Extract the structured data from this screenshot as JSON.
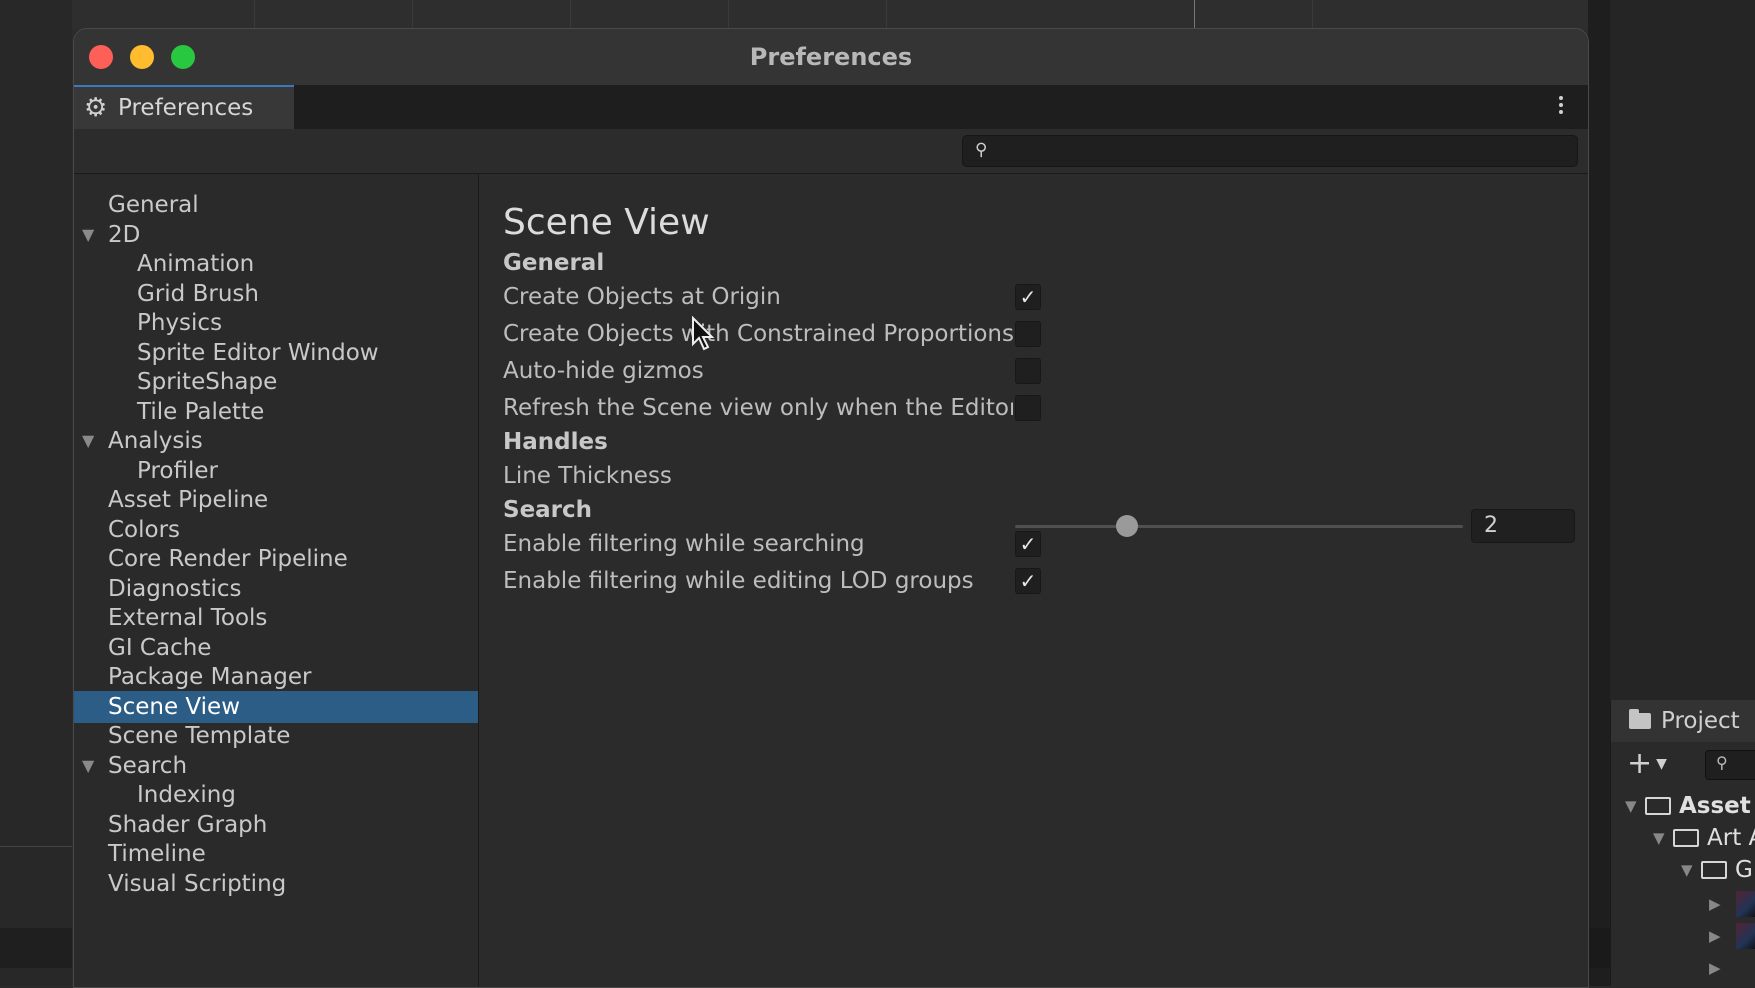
{
  "window": {
    "title": "Preferences"
  },
  "tab": {
    "label": "Preferences",
    "icon": "gear-icon"
  },
  "search": {
    "placeholder": "",
    "value": ""
  },
  "sidebar": {
    "items": [
      {
        "label": "General",
        "level": 0,
        "expandable": false
      },
      {
        "label": "2D",
        "level": 0,
        "expandable": true
      },
      {
        "label": "Animation",
        "level": 1,
        "expandable": false
      },
      {
        "label": "Grid Brush",
        "level": 1,
        "expandable": false
      },
      {
        "label": "Physics",
        "level": 1,
        "expandable": false
      },
      {
        "label": "Sprite Editor Window",
        "level": 1,
        "expandable": false
      },
      {
        "label": "SpriteShape",
        "level": 1,
        "expandable": false
      },
      {
        "label": "Tile Palette",
        "level": 1,
        "expandable": false
      },
      {
        "label": "Analysis",
        "level": 0,
        "expandable": true
      },
      {
        "label": "Profiler",
        "level": 1,
        "expandable": false
      },
      {
        "label": "Asset Pipeline",
        "level": 0,
        "expandable": false
      },
      {
        "label": "Colors",
        "level": 0,
        "expandable": false
      },
      {
        "label": "Core Render Pipeline",
        "level": 0,
        "expandable": false
      },
      {
        "label": "Diagnostics",
        "level": 0,
        "expandable": false
      },
      {
        "label": "External Tools",
        "level": 0,
        "expandable": false
      },
      {
        "label": "GI Cache",
        "level": 0,
        "expandable": false
      },
      {
        "label": "Package Manager",
        "level": 0,
        "expandable": false
      },
      {
        "label": "Scene View",
        "level": 0,
        "expandable": false,
        "selected": true
      },
      {
        "label": "Scene Template",
        "level": 0,
        "expandable": false
      },
      {
        "label": "Search",
        "level": 0,
        "expandable": true
      },
      {
        "label": "Indexing",
        "level": 1,
        "expandable": false
      },
      {
        "label": "Shader Graph",
        "level": 0,
        "expandable": false
      },
      {
        "label": "Timeline",
        "level": 0,
        "expandable": false
      },
      {
        "label": "Visual Scripting",
        "level": 0,
        "expandable": false
      }
    ]
  },
  "content": {
    "title": "Scene View",
    "general": {
      "header": "General",
      "create_origin": {
        "label": "Create Objects at Origin",
        "checked": true
      },
      "create_constrained": {
        "label": "Create Objects with Constrained Proportions",
        "checked": false
      },
      "autohide_gizmos": {
        "label": "Auto-hide gizmos",
        "checked": false
      },
      "refresh_scene": {
        "label": "Refresh the Scene view only when the Editor",
        "checked": false
      }
    },
    "handles": {
      "header": "Handles",
      "line_thickness": {
        "label": "Line Thickness",
        "value": "2",
        "min": 1,
        "max": 5
      }
    },
    "search_section": {
      "header": "Search",
      "filter_searching": {
        "label": "Enable filtering while searching",
        "checked": true
      },
      "filter_lod": {
        "label": "Enable filtering while editing LOD groups",
        "checked": true
      }
    }
  },
  "project_panel": {
    "tab_label": "Project",
    "tree": [
      {
        "label": "Asset",
        "level": 0
      },
      {
        "label": "Art A",
        "level": 1
      },
      {
        "label": "G",
        "level": 2
      }
    ]
  },
  "check_glyph": "✓",
  "colors": {
    "accent": "#2c5d87",
    "tab_indicator": "#3a79bb"
  }
}
